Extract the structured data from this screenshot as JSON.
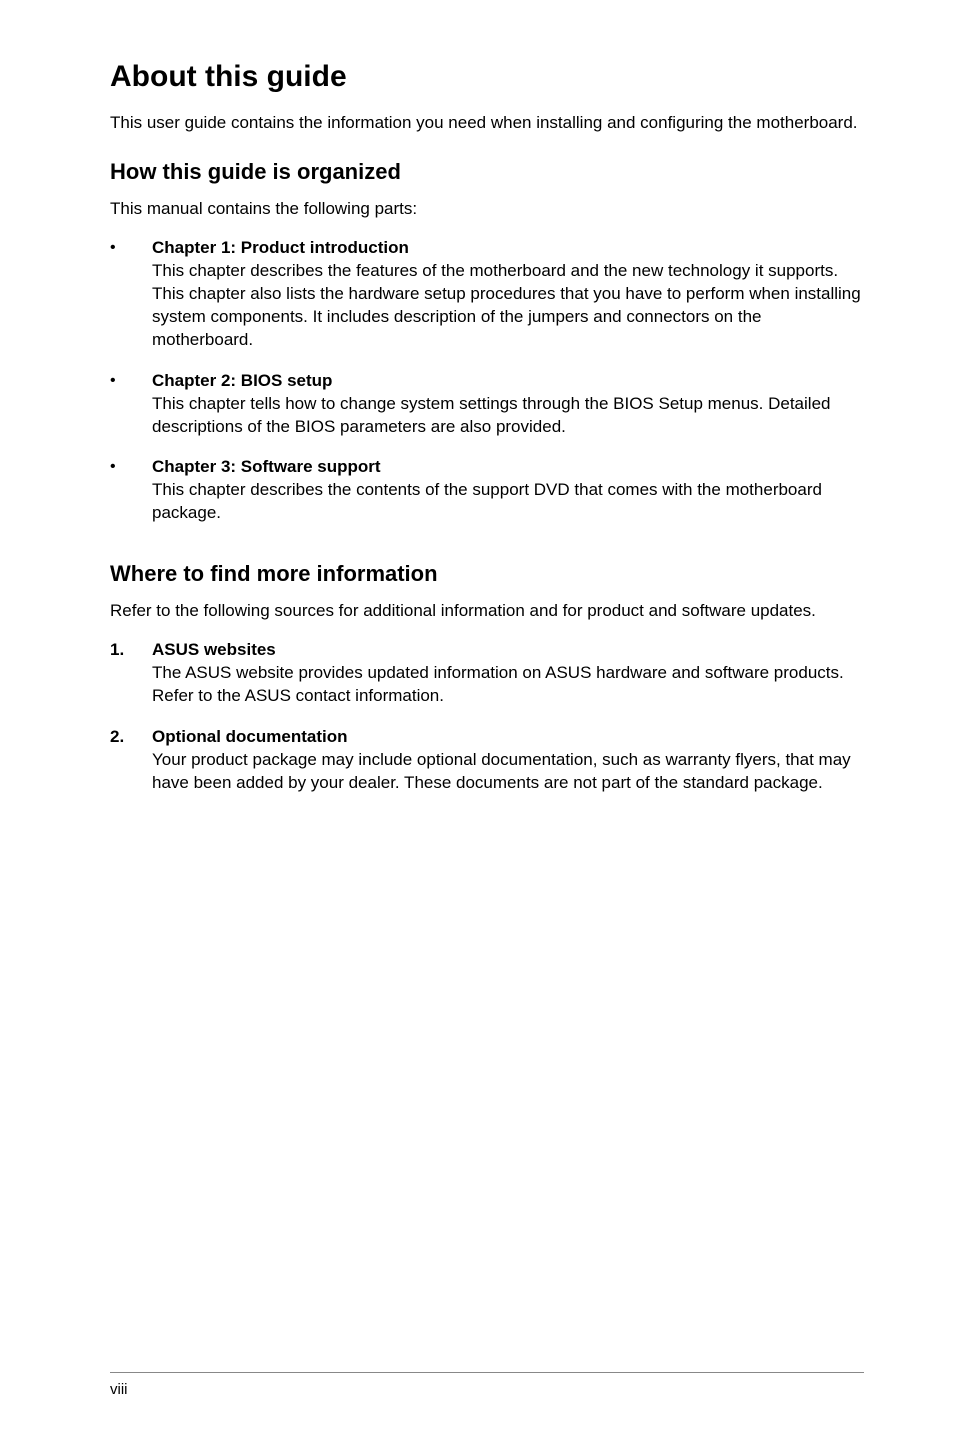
{
  "title": "About this guide",
  "intro": "This user guide contains the information you need when installing and configuring the motherboard.",
  "section1": {
    "heading": "How this guide is organized",
    "lead": "This manual contains the following parts:",
    "items": [
      {
        "marker": "•",
        "title": "Chapter 1: Product introduction",
        "text": "This chapter describes the features of the motherboard and the new technology it supports. This chapter also lists the hardware setup procedures that you have to perform when installing system components. It includes description of the jumpers and connectors on the motherboard."
      },
      {
        "marker": "•",
        "title": "Chapter 2: BIOS setup",
        "text": "This chapter tells how to change system settings through the BIOS Setup menus. Detailed descriptions of the BIOS parameters are also provided."
      },
      {
        "marker": "•",
        "title": "Chapter 3: Software support",
        "text": "This chapter describes the contents of the support DVD that comes with the motherboard package."
      }
    ]
  },
  "section2": {
    "heading": "Where to find more information",
    "lead": "Refer to the following sources for additional information and for product and software updates.",
    "items": [
      {
        "marker": "1.",
        "title": "ASUS websites",
        "text": "The ASUS website provides updated information on ASUS hardware and software products. Refer to the ASUS contact information."
      },
      {
        "marker": "2.",
        "title": "Optional documentation",
        "text": "Your product package may include optional documentation, such as warranty flyers, that may have been added by your dealer. These documents are not part of the standard package."
      }
    ]
  },
  "footer": "viii"
}
